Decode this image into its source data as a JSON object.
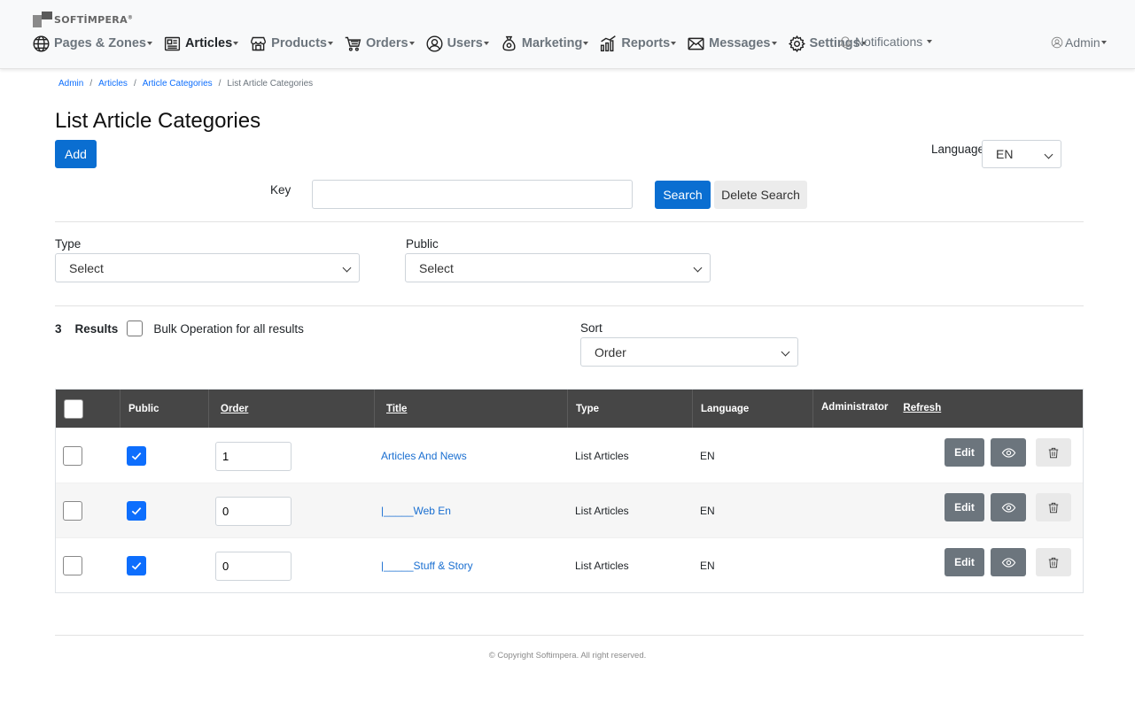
{
  "brand": {
    "name": "SOFTİMPERA",
    "mark": "®"
  },
  "nav": {
    "items": [
      {
        "label": "Pages & Zones",
        "icon": "globe-icon"
      },
      {
        "label": "Articles",
        "icon": "article-icon",
        "active": true
      },
      {
        "label": "Products",
        "icon": "store-icon"
      },
      {
        "label": "Orders",
        "icon": "cart-icon"
      },
      {
        "label": "Users",
        "icon": "user-circle-icon"
      },
      {
        "label": "Marketing",
        "icon": "money-bag-icon"
      },
      {
        "label": "Reports",
        "icon": "chart-icon"
      },
      {
        "label": "Messages",
        "icon": "envelope-icon"
      },
      {
        "label": "Settings",
        "icon": "gear-icon"
      }
    ],
    "notifications": "Notifications",
    "admin": "Admin"
  },
  "breadcrumb": {
    "b0": "Admin",
    "b1": "Articles",
    "b2": "Article Categories",
    "b3": "List Article Categories"
  },
  "page": {
    "title": "List Article Categories",
    "add": "Add"
  },
  "language": {
    "label": "Language",
    "value": "EN"
  },
  "search": {
    "key_label": "Key",
    "key_value": "",
    "search": "Search",
    "delete": "Delete Search"
  },
  "filters": {
    "type_label": "Type",
    "type_value": "Select",
    "public_label": "Public",
    "public_value": "Select"
  },
  "results": {
    "count": "3",
    "label": "Results",
    "bulk": "Bulk Operation for all results"
  },
  "sort": {
    "label": "Sort",
    "value": "Order"
  },
  "table": {
    "headers": {
      "public": "Public",
      "order": "Order",
      "title": "Title",
      "type": "Type",
      "language": "Language",
      "administrator": "Administrator",
      "refresh": "Refresh"
    },
    "rows": [
      {
        "public": true,
        "order": "1",
        "title": "Articles And News",
        "type": "List Articles",
        "language": "EN",
        "edit": "Edit"
      },
      {
        "public": true,
        "order": "0",
        "title": "|_____Web En",
        "type": "List Articles",
        "language": "EN",
        "edit": "Edit"
      },
      {
        "public": true,
        "order": "0",
        "title": "|_____Stuff & Story",
        "type": "List Articles",
        "language": "EN",
        "edit": "Edit"
      }
    ]
  },
  "footer": {
    "copyright": "© Copyright Softimpera. All right reserved."
  },
  "colors": {
    "primary": "#0a6ed1",
    "header_dark": "#464646",
    "link": "#1a6fd1",
    "secondary_btn": "#6c757d"
  }
}
